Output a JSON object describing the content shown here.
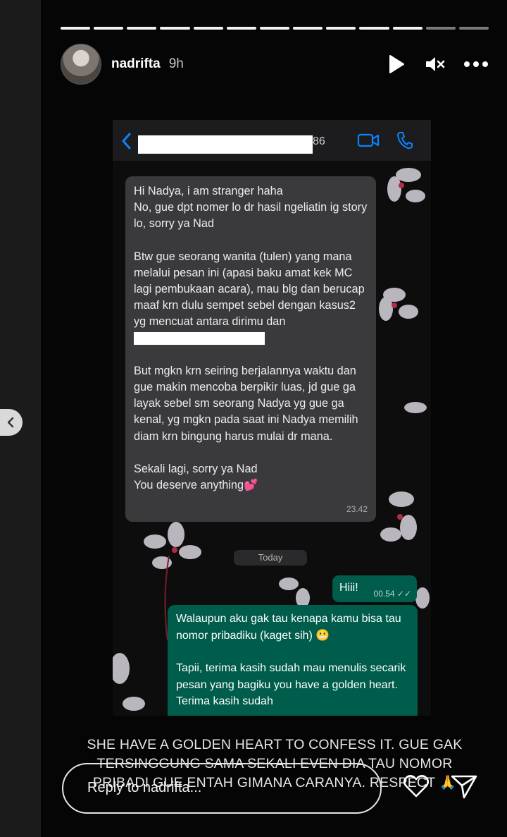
{
  "story": {
    "username": "nadrifta",
    "time_ago": "9h",
    "progress": {
      "total_segments": 13,
      "completed_segments": 11
    }
  },
  "chat": {
    "contact_number_suffix": "86",
    "incoming": {
      "paragraphs": [
        "Hi Nadya, i am stranger haha\nNo, gue dpt nomer lo dr hasil ngeliatin ig story lo, sorry ya Nad",
        "Btw gue seorang wanita (tulen) yang mana melalui pesan ini (apasi baku amat kek MC lagi pembukaan acara), mau blg dan berucap maaf krn dulu sempet sebel dengan kasus2 yg mencuat antara dirimu dan",
        "But mgkn krn seiring berjalannya waktu dan gue makin mencoba berpikir luas, jd gue ga layak sebel sm seorang Nadya yg gue ga kenal, yg mgkn pada saat ini Nadya memilih diam krn bingung harus mulai dr mana.",
        "Sekali lagi, sorry ya Nad\nYou deserve anything💕"
      ],
      "time": "23.42"
    },
    "date_divider": "Today",
    "outgoing_short": {
      "text": "Hiii!",
      "time": "00.54"
    },
    "outgoing_long": {
      "paragraphs": [
        "Walaupun aku gak tau kenapa kamu bisa tau nomor pribadiku (kaget sih) 😬",
        "Tapii, terima kasih sudah mau menulis secarik pesan yang bagiku you have a golden heart. Terima kasih sudah"
      ]
    }
  },
  "caption": "SHE HAVE A GOLDEN HEART TO CONFESS IT. GUE GAK TERSINGGUNG SAMA SEKALI EVEN DIA TAU NOMOR PRIBADI GUE ENTAH GIMANA CARANYA. RESPECT 🙏",
  "reply": {
    "placeholder": "Reply to nadrifta..."
  },
  "colors": {
    "incoming_bubble": "#3a3a3c",
    "outgoing_bubble": "#005c4b",
    "accent_blue": "#0a84ff"
  }
}
